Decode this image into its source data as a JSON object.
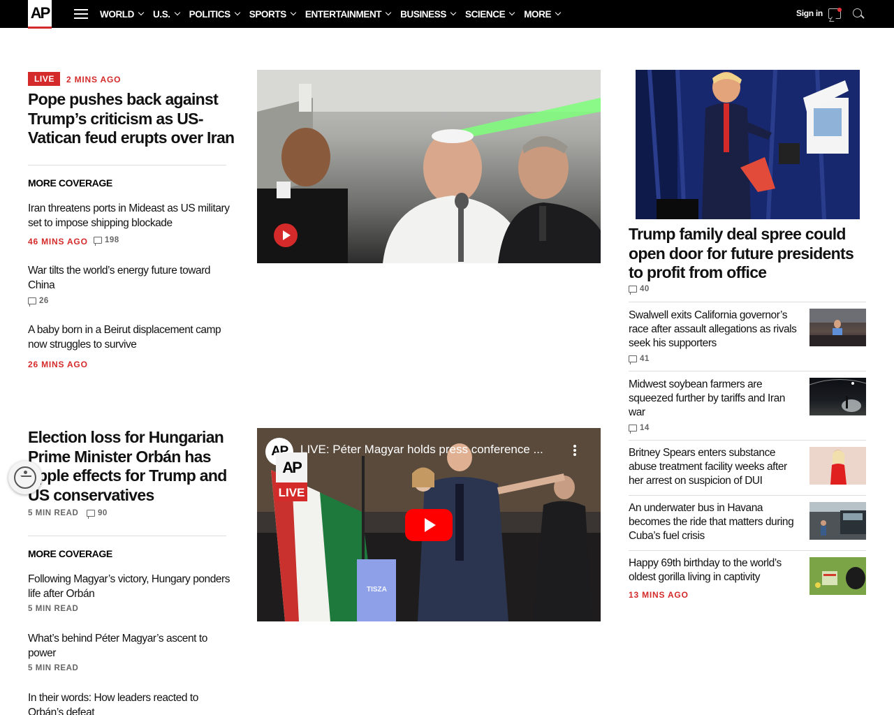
{
  "nav": {
    "logo": "AP",
    "menu": [
      "WORLD",
      "U.S.",
      "POLITICS",
      "SPORTS",
      "ENTERTAINMENT",
      "BUSINESS",
      "SCIENCE",
      "MORE"
    ],
    "sign_in": "Sign in"
  },
  "lead1": {
    "badge": "LIVE",
    "time": "2 MINS AGO",
    "headline": "Pope pushes back against Trump’s criticism as US-Vatican feud erupts over Iran",
    "more_coverage": "MORE COVERAGE",
    "related": [
      {
        "title": "Iran threatens ports in Mideast as US military set to impose shipping blockade",
        "time": "46 MINS AGO",
        "comments": "198"
      },
      {
        "title": "War tilts the world’s energy future toward China",
        "comments": "26"
      },
      {
        "title": "A baby born in a Beirut displacement camp now struggles to survive",
        "time": "26 MINS AGO"
      }
    ]
  },
  "lead2": {
    "headline": "Election loss for Hungarian Prime Minister Orbán has ripple effects for Trump and US conservatives",
    "read": "5 MIN READ",
    "comments": "90",
    "more_coverage": "MORE COVERAGE",
    "related": [
      {
        "title": "Following Magyar’s victory, Hungary ponders life after Orbán",
        "read": "5 MIN READ"
      },
      {
        "title": "What’s behind Péter Magyar’s ascent to power",
        "read": "5 MIN READ"
      },
      {
        "title": "In their words: How leaders reacted to Orbán’s defeat"
      }
    ],
    "video": {
      "channel_logo": "AP",
      "title": "LIVE: Péter Magyar holds press conference ...",
      "live_logo": "AP",
      "live_label": "LIVE",
      "podium": "TISZA"
    }
  },
  "right": {
    "top": {
      "headline": "Trump family deal spree could open door for future presidents to profit from office",
      "comments": "40"
    },
    "list": [
      {
        "title": "Swalwell exits California governor’s race after assault allegations as rivals seek his supporters",
        "comments": "41"
      },
      {
        "title": "Midwest soybean farmers are squeezed further by tariffs and Iran war",
        "comments": "14"
      },
      {
        "title": "Britney Spears enters substance abuse treatment facility weeks after her arrest on suspicion of DUI"
      },
      {
        "title": "An underwater bus in Havana becomes the ride that matters during Cuba’s fuel crisis"
      },
      {
        "title": "Happy 69th birthday to the world’s oldest gorilla living in captivity",
        "time": "13 MINS AGO"
      }
    ]
  },
  "colors": {
    "ap_red": "#d52a2a",
    "nav_bg": "#000000",
    "youtube_red": "#ff0000"
  }
}
